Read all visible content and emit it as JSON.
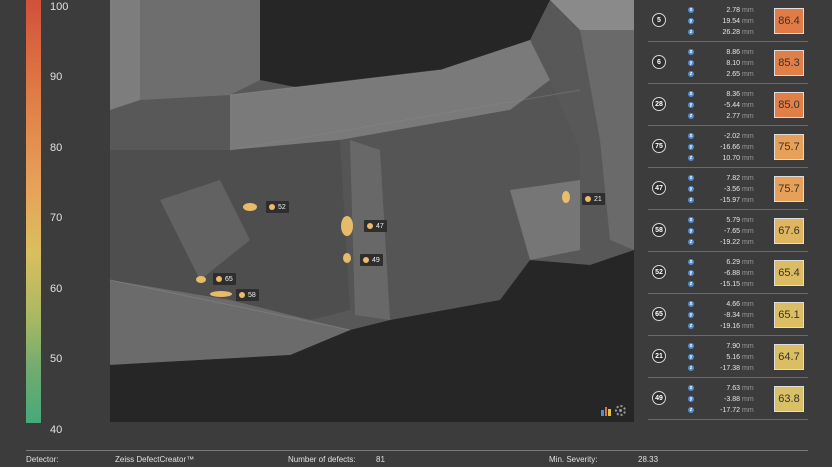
{
  "scale": {
    "ticks": [
      "100",
      "90",
      "80",
      "70",
      "60",
      "50",
      "40"
    ]
  },
  "viewport": {
    "markers": [
      {
        "id": "52"
      },
      {
        "id": "47"
      },
      {
        "id": "49"
      },
      {
        "id": "65"
      },
      {
        "id": "58"
      },
      {
        "id": "21"
      }
    ],
    "icons": [
      "bar-chart-icon",
      "gear-icon"
    ]
  },
  "defects": [
    {
      "id": "5",
      "x": "2.78",
      "y": "19.54",
      "z": "26.28",
      "unit": "mm",
      "score": "86.4",
      "color": "#e07b45"
    },
    {
      "id": "6",
      "x": "8.86",
      "y": "8.10",
      "z": "2.65",
      "unit": "mm",
      "score": "85.3",
      "color": "#e07f47"
    },
    {
      "id": "28",
      "x": "8.36",
      "y": "-5.44",
      "z": "2.77",
      "unit": "mm",
      "score": "85.0",
      "color": "#e08048"
    },
    {
      "id": "75",
      "x": "-2.02",
      "y": "-16.66",
      "z": "10.70",
      "unit": "mm",
      "score": "75.7",
      "color": "#e6a058"
    },
    {
      "id": "47",
      "x": "7.82",
      "y": "-3.56",
      "z": "-15.97",
      "unit": "mm",
      "score": "75.7",
      "color": "#e6a058"
    },
    {
      "id": "58",
      "x": "5.79",
      "y": "-7.65",
      "z": "-19.22",
      "unit": "mm",
      "score": "67.6",
      "color": "#e0b560"
    },
    {
      "id": "52",
      "x": "6.29",
      "y": "-6.88",
      "z": "-15.15",
      "unit": "mm",
      "score": "65.4",
      "color": "#dcbc63"
    },
    {
      "id": "65",
      "x": "4.66",
      "y": "-8.34",
      "z": "-19.16",
      "unit": "mm",
      "score": "65.1",
      "color": "#dcbd63"
    },
    {
      "id": "21",
      "x": "7.90",
      "y": "5.16",
      "z": "-17.38",
      "unit": "mm",
      "score": "64.7",
      "color": "#dbbe64"
    },
    {
      "id": "49",
      "x": "7.63",
      "y": "-3.88",
      "z": "-17.72",
      "unit": "mm",
      "score": "63.8",
      "color": "#d8c066"
    }
  ],
  "axis_labels": {
    "x": "x",
    "y": "y",
    "z": "z"
  },
  "footer": {
    "detector_label": "Detector:",
    "detector_value": "Zeiss DefectCreator™",
    "defects_label": "Number of defects:",
    "defects_value": "81",
    "severity_label": "Min. Severity:",
    "severity_value": "28.33"
  }
}
